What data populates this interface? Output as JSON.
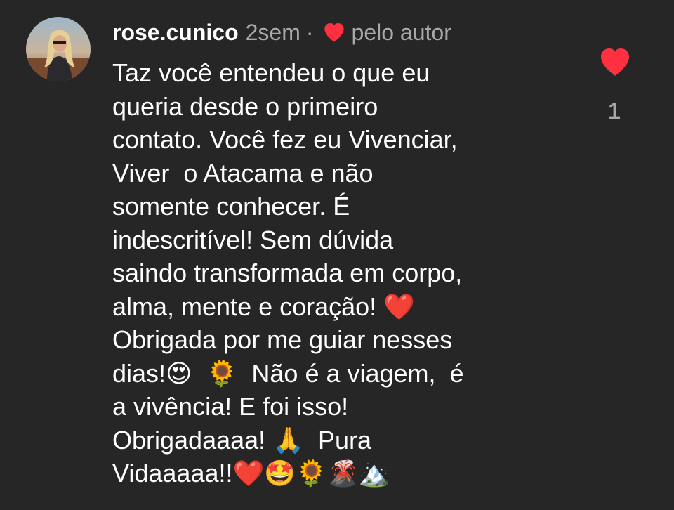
{
  "comment": {
    "username": "rose.cunico",
    "timestamp": "2sem",
    "separator": "·",
    "author_heart_icon": "heart-icon",
    "author_label": "pelo autor",
    "text": "Taz você entendeu o que eu\nqueria desde o primeiro\ncontato. Você fez eu Vivenciar,\nViver  o Atacama e não\nsomente conhecer. É\nindescritível! Sem dúvida\nsaindo transformada em corpo,\nalma, mente e coração! ❤️\nObrigada por me guiar nesses\ndias!😍  🌻  Não é a viagem,  é\na vivência! E foi isso!\nObrigadaaaa! 🙏  Pura\nVidaaaaa!!❤️🤩🌻🌋🏔️"
  },
  "like": {
    "icon": "heart-icon",
    "count": "1"
  },
  "colors": {
    "background": "#262626",
    "heart": "#ff3040",
    "muted_text": "#a8a8a8",
    "primary_text": "#ffffff"
  }
}
